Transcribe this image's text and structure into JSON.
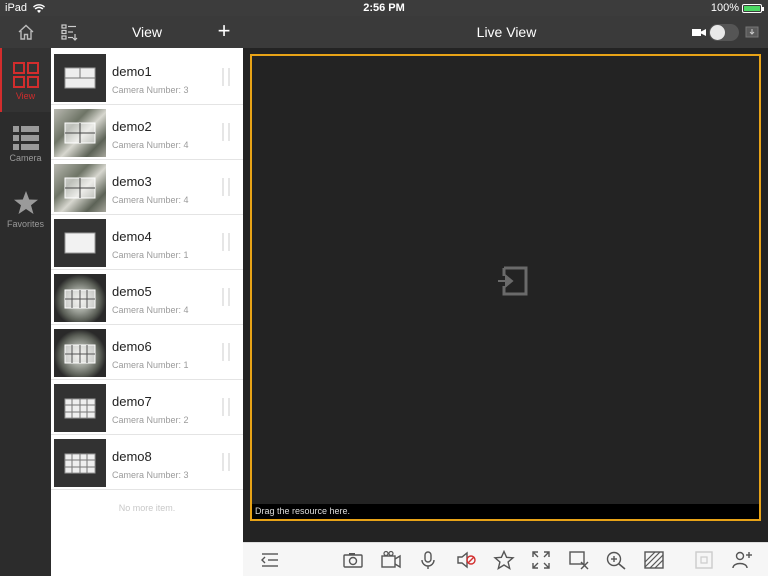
{
  "status_bar": {
    "device": "iPad",
    "time": "2:56 PM",
    "battery": "100%"
  },
  "nav": {
    "view_title": "View",
    "add_symbol": "+",
    "live_title": "Live View"
  },
  "rail": {
    "tabs": [
      {
        "label": "View",
        "icon": "grid-view-icon",
        "active": true
      },
      {
        "label": "Camera",
        "icon": "camera-list-icon",
        "active": false
      },
      {
        "label": "Favorites",
        "icon": "star-icon",
        "active": false
      }
    ]
  },
  "views": [
    {
      "name": "demo1",
      "camera_number": "Camera Number: 3"
    },
    {
      "name": "demo2",
      "camera_number": "Camera Number: 4"
    },
    {
      "name": "demo3",
      "camera_number": "Camera Number: 4"
    },
    {
      "name": "demo4",
      "camera_number": "Camera Number: 1"
    },
    {
      "name": "demo5",
      "camera_number": "Camera Number: 4"
    },
    {
      "name": "demo6",
      "camera_number": "Camera Number: 1"
    },
    {
      "name": "demo7",
      "camera_number": "Camera Number: 2"
    },
    {
      "name": "demo8",
      "camera_number": "Camera Number: 3"
    }
  ],
  "list_footer": "No more item.",
  "live": {
    "drop_hint": "Drag the resource here.",
    "accent": "#e8a317"
  },
  "toolbar_icons": [
    "collapse-icon",
    "snapshot-icon",
    "record-icon",
    "microphone-icon",
    "audio-off-icon",
    "favorite-icon",
    "fullscreen-icon",
    "close-all-icon",
    "zoom-icon",
    "image-quality-icon",
    "ptz-icon",
    "add-user-icon"
  ],
  "colors": {
    "accent_red": "#d22d2d",
    "selection_yellow": "#e8a317"
  }
}
